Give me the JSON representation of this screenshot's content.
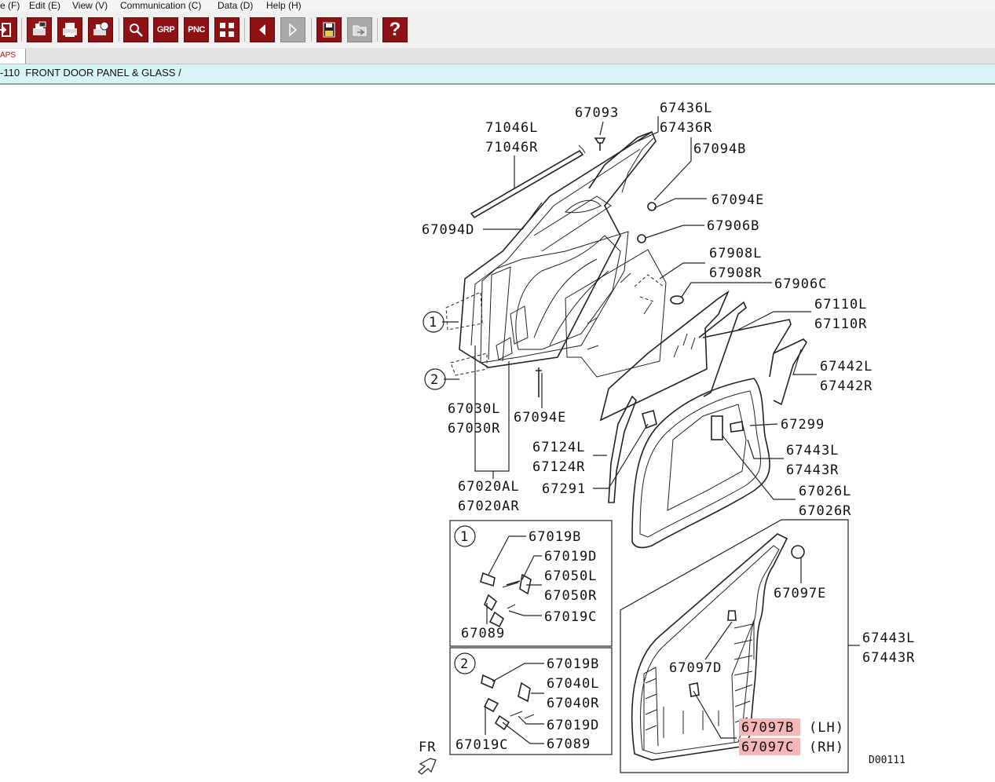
{
  "menu": [
    "e (F)",
    "Edit (E)",
    "View (V)",
    "Communication (C)",
    "Data (D)",
    "Help (H)"
  ],
  "toolbar": {
    "grp": "GRP",
    "pnc": "PNC",
    "help": "?"
  },
  "tab_label": "APS",
  "breadcrumb": "-110  FRONT DOOR PANEL & GLASS /",
  "diagram": {
    "code": "D00111",
    "fr": "FR",
    "callout1": "1",
    "callout2": "2",
    "inset1_num": "1",
    "inset2_num": "2",
    "parts": {
      "p71046L": "71046L",
      "p71046R": "71046R",
      "p67093": "67093",
      "p67436L": "67436L",
      "p67436R": "67436R",
      "p67094B": "67094B",
      "p67094E_a": "67094E",
      "p67906B": "67906B",
      "p67094D": "67094D",
      "p67908L": "67908L",
      "p67908R": "67908R",
      "p67906C": "67906C",
      "p67110L": "67110L",
      "p67110R": "67110R",
      "p67442L": "67442L",
      "p67442R": "67442R",
      "p67030L": "67030L",
      "p67030R": "67030R",
      "p67094E_b": "67094E",
      "p67299": "67299",
      "p67124L": "67124L",
      "p67124R": "67124R",
      "p67443L_a": "67443L",
      "p67443R_a": "67443R",
      "p67291": "67291",
      "p67026L": "67026L",
      "p67026R": "67026R",
      "p67020AL": "67020AL",
      "p67020AR": "67020AR",
      "p67019B_1": "67019B",
      "p67019D_1": "67019D",
      "p67050L": "67050L",
      "p67050R": "67050R",
      "p67019C_1": "67019C",
      "p67089_1": "67089",
      "p67019B_2": "67019B",
      "p67040L": "67040L",
      "p67040R": "67040R",
      "p67019D_2": "67019D",
      "p67019C_2": "67019C",
      "p67089_2": "67089",
      "p67097E": "67097E",
      "p67097D": "67097D",
      "p67443L_b": "67443L",
      "p67443R_b": "67443R",
      "p67097B": "67097B",
      "p67097C": "67097C",
      "lh": "(LH)",
      "rh": "(RH)"
    },
    "highlight_color": "#f4b6b6"
  },
  "colors": {
    "toolbar_icon": "#8e1116",
    "breadcrumb_bg": "#d6f3f6"
  }
}
